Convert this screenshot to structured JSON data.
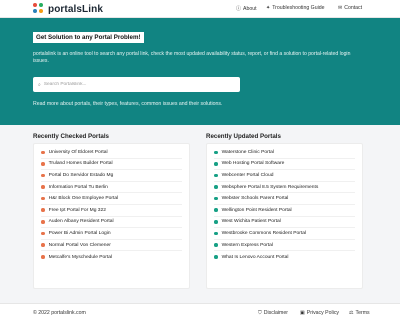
{
  "brand": {
    "name": "portalsLink",
    "dot_colors": [
      "#e74c3c",
      "#27ae60",
      "#2980b9",
      "#f39c12"
    ]
  },
  "nav": [
    {
      "label": "About",
      "icon": "info-circle-icon"
    },
    {
      "label": "Troubleshooting Guide",
      "icon": "lightbulb-icon"
    },
    {
      "label": "Contact",
      "icon": "envelope-icon"
    }
  ],
  "hero": {
    "title": "Get Solution to any Portal Problem!",
    "description": "portalslink is an online tool to search any portal link, check the most updated availability status, report, or find a solution to portal-related login issues.",
    "search_placeholder": "Search Portalslink...",
    "more_text": "Read more about portals, their types, features, common issues and their solutions.",
    "background": "#118482"
  },
  "recently_checked": {
    "title": "Recently Checked Portals",
    "dot_color": "#e8734a",
    "items": [
      "University Of Eldoret Portal",
      "Truland Homes Builder Portal",
      "Portal Do Servidor Estado Mg",
      "Information Portal Tu Berlin",
      "H&r Block One Employee Portal",
      "Free Ipt Portal For Mg 322",
      "Auden Albany Resident Portal",
      "Power Bi Admin Portal Login",
      "Normal Portal Von Clemener",
      "Metcalfe's Myschedule Portal"
    ]
  },
  "recently_updated": {
    "title": "Recently Updated Portals",
    "dot_color": "#16a085",
    "items": [
      "Waterstone Clinic Portal",
      "Web Hosting Portal Software",
      "Webcenter Portal Cloud",
      "Websphere Portal 8.5 System Requirements",
      "Webster Schools Parent Portal",
      "Wellington Point Resident Portal",
      "West Wichita Patient Portal",
      "Westbrooke Commons Resident Portal",
      "Western Express Portal",
      "What Is Lenovo Account Portal"
    ]
  },
  "footer": {
    "copyright": "© 2022 portalslink.com",
    "links": [
      {
        "label": "Disclaimer",
        "icon": "shield-icon"
      },
      {
        "label": "Privacy Policy",
        "icon": "lock-icon"
      },
      {
        "label": "Terms",
        "icon": "gavel-icon"
      }
    ]
  }
}
